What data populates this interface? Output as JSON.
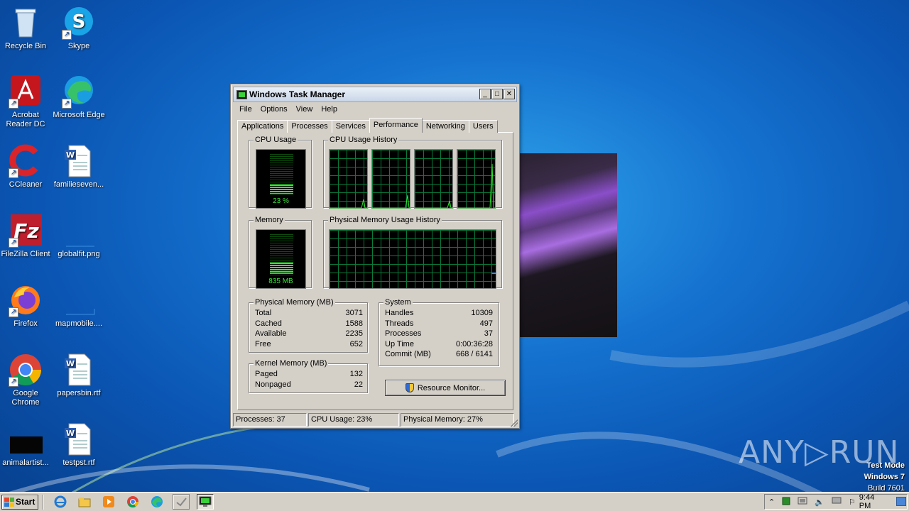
{
  "desktop": {
    "icons": [
      {
        "label": "Recycle Bin"
      },
      {
        "label": "Skype"
      },
      {
        "label": "Acrobat Reader DC"
      },
      {
        "label": "Microsoft Edge"
      },
      {
        "label": "CCleaner"
      },
      {
        "label": "familieseven..."
      },
      {
        "label": "FileZilla Client"
      },
      {
        "label": "globalfit.png"
      },
      {
        "label": "Firefox"
      },
      {
        "label": "mapmobile...."
      },
      {
        "label": "Google Chrome"
      },
      {
        "label": "papersbin.rtf"
      },
      {
        "label": "animalartist..."
      },
      {
        "label": "testpst.rtf"
      }
    ]
  },
  "window": {
    "title": "Windows Task Manager",
    "controls": {
      "minimize": "_",
      "maximize": "□",
      "close": "✕"
    },
    "menu": [
      "File",
      "Options",
      "View",
      "Help"
    ],
    "tabs": [
      "Applications",
      "Processes",
      "Services",
      "Performance",
      "Networking",
      "Users"
    ],
    "active_tab": "Performance"
  },
  "performance": {
    "cpu_usage": {
      "title": "CPU Usage",
      "value": "23 %",
      "fraction": 0.23
    },
    "cpu_history": {
      "title": "CPU Usage History",
      "cores": 4
    },
    "memory": {
      "title": "Memory",
      "value": "835 MB",
      "fraction": 0.27
    },
    "memory_history": {
      "title": "Physical Memory Usage History"
    },
    "physical_memory": {
      "title": "Physical Memory (MB)",
      "rows": [
        {
          "label": "Total",
          "value": "3071"
        },
        {
          "label": "Cached",
          "value": "1588"
        },
        {
          "label": "Available",
          "value": "2235"
        },
        {
          "label": "Free",
          "value": "652"
        }
      ]
    },
    "kernel_memory": {
      "title": "Kernel Memory (MB)",
      "rows": [
        {
          "label": "Paged",
          "value": "132"
        },
        {
          "label": "Nonpaged",
          "value": "22"
        }
      ]
    },
    "system": {
      "title": "System",
      "rows": [
        {
          "label": "Handles",
          "value": "10309"
        },
        {
          "label": "Threads",
          "value": "497"
        },
        {
          "label": "Processes",
          "value": "37"
        },
        {
          "label": "Up Time",
          "value": "0:00:36:28"
        },
        {
          "label": "Commit (MB)",
          "value": "668 / 6141"
        }
      ]
    },
    "resource_monitor_button": "Resource Monitor..."
  },
  "statusbar": {
    "processes": "Processes: 37",
    "cpu": "CPU Usage: 23%",
    "memory": "Physical Memory: 27%"
  },
  "watermark": {
    "text": "ANY▷RUN"
  },
  "test_mode": {
    "line1": "Test Mode",
    "line2": "Windows 7",
    "line3": "Build 7601"
  },
  "taskbar": {
    "start_label": "Start",
    "clock": "9:44 PM"
  },
  "colors": {
    "desktop_blue": "#1572cf",
    "window_face": "#d4d0c8",
    "graph_green": "#2ee82e",
    "grid_green": "#0a7a3a"
  }
}
